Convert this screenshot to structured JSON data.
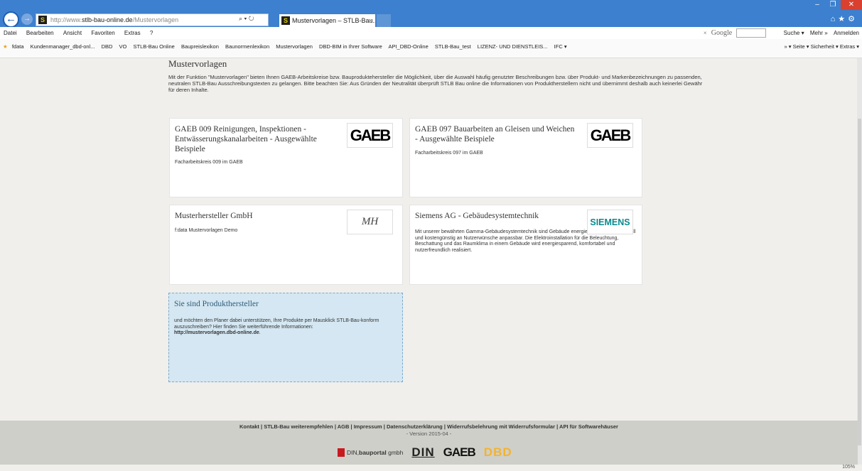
{
  "browser": {
    "url_prefix": "http://www.",
    "url_host": "stlb-bau-online.de",
    "url_path": "/Mustervorlagen",
    "addr_tools": "⌕ ▾ ↻",
    "tab_title": "Mustervorlagen – STLB-Bau...",
    "tab_close": "×",
    "win_min": "–",
    "win_max": "❐",
    "win_close": "✕",
    "right_tools": "⌂★⚙"
  },
  "menu": {
    "items": [
      "Datei",
      "Bearbeiten",
      "Ansicht",
      "Favoriten",
      "Extras",
      "?"
    ],
    "right_x": "×",
    "right_google": "Google",
    "right_suche": "Suche ▾",
    "right_mehr": "Mehr »",
    "right_anmelden": "Anmelden"
  },
  "favorites": {
    "items": [
      "fdata",
      "Kundenmanager_dbd-onl...",
      "DBD",
      "VO",
      "STLB-Bau Online",
      "Baupreislexikon",
      "Baunormenlexikon",
      "Mustervorlagen",
      "DBD-BIM in Ihrer Software",
      "API_DBD-Online",
      "STLB-Bau_test",
      "LIZENZ- UND DIENSTLEIS...",
      "IFC ▾"
    ],
    "right": "» ▾ Seite ▾ Sicherheit ▾ Extras ▾"
  },
  "page": {
    "title": "Mustervorlagen",
    "intro": "Mit der Funktion \"Mustervorlagen\" bieten Ihnen GAEB-Arbeitskreise bzw. Bauproduktehersteller die Möglichkeit, über die Auswahl häufig genutzter Beschreibungen bzw. über Produkt- und Markenbezeichnungen zu passenden, neutralen STLB-Bau Ausschreibungstexten zu gelangen. Bitte beachten Sie: Aus Gründen der Neutralität überprüft STLB Bau online die Informationen von Produktherstellern nicht und übernimmt deshalb auch keinerlei Gewähr für deren Inhalte."
  },
  "cards": [
    {
      "title": "GAEB 009 Reinigungen, Inspektionen - Entwässerungskanalarbeiten - Ausgewählte Beispiele",
      "desc": "Facharbeitskreis 009 im GAEB",
      "logo": "GAEB"
    },
    {
      "title": "GAEB 097 Bauarbeiten an Gleisen und Weichen - Ausgewählte Beispiele",
      "desc": "Facharbeitskreis 097 im GAEB",
      "logo": "GAEB"
    },
    {
      "title": "Musterhersteller GmbH",
      "desc": "f:data Mustervorlagen Demo",
      "logo": "MH"
    },
    {
      "title": "Siemens AG - Gebäudesystemtechnik",
      "desc": "Mit unserer bewährten Gamma-Gebäudesystemtechnik sind Gebäude energieeffizient sowie schnell und kostengünstig an Nutzerwünsche anpassbar. Die Elektroinstallation für die Beleuchtung, Beschattung und das Raumklima in einem Gebäude wird energiesparend, komfortabel und nutzerfreundlich realisiert.",
      "logo": "SIEMENS"
    }
  ],
  "producer": {
    "title": "Sie sind Produkthersteller",
    "text": "und möchten den Planer dabei unterstützen, Ihre Produkte per Mausklick STLB-Bau-konform auszuschreiben? Hier finden Sie weiterführende Informationen:",
    "link": "http://mustervorlagen.dbd-online.de",
    "link_suffix": "."
  },
  "footer": {
    "links": [
      "Kontakt",
      "STLB-Bau weiterempfehlen",
      "AGB",
      "Impressum",
      "Datenschutzerklärung",
      "Widerrufsbelehrung mit Widerrufsformular",
      "API für Softwarehäuser"
    ],
    "separator": " | ",
    "version": "- Version 2015-04 -",
    "logo_bauportal_1": "DIN",
    "logo_bauportal_2": "bauportal",
    "logo_bauportal_3": "gmbh",
    "logo_din": "DIN",
    "logo_gaeb": "GAEB",
    "logo_dbd": "DBD"
  },
  "status": {
    "zoom": "105%"
  }
}
